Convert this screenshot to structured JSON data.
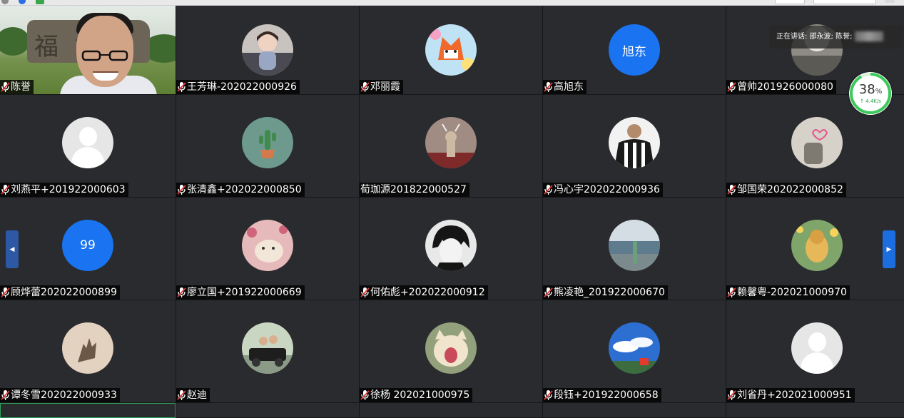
{
  "colors": {
    "tile_bg": "#2a2b2e",
    "nameplate_bg": "#000000",
    "accent_blue": "#1a73f0",
    "net_green": "#3cc85a"
  },
  "speaking_label": "正在讲话: 邵永波; 陈誉;",
  "network": {
    "percent": "38",
    "percent_unit": "%",
    "rate": "↑ 4.4K/s",
    "level": 0.38
  },
  "participants": [
    {
      "name": "陈誉",
      "avatar": "camera",
      "mic": true
    },
    {
      "name": "王芳琳-202022000926",
      "avatar": "girl-photo",
      "mic": true
    },
    {
      "name": "邓丽霞",
      "avatar": "cartoon-fox",
      "mic": true
    },
    {
      "name": "高旭东",
      "avatar": "text",
      "avatar_text": "旭东",
      "color": "#1a73f0",
      "mic": true
    },
    {
      "name": "曾帅201926000080",
      "avatar": "mirror-photo",
      "mic": true
    },
    {
      "name": "刘燕平+201922000603",
      "avatar": "default",
      "mic": true
    },
    {
      "name": "张清鑫+202022000850",
      "avatar": "cactus",
      "mic": true
    },
    {
      "name": "荀珈源201822000527",
      "avatar": "deer-art",
      "mic": false
    },
    {
      "name": "冯心宇202022000936",
      "avatar": "footballer",
      "mic": true
    },
    {
      "name": "邹国荣202022000852",
      "avatar": "doodle-heart",
      "mic": true
    },
    {
      "name": "顾烨蕾202022000899",
      "avatar": "text",
      "avatar_text": "99",
      "color": "#1a73f0",
      "mic": true
    },
    {
      "name": "廖立国+201922000669",
      "avatar": "cat-flowers",
      "mic": true
    },
    {
      "name": "何佑彪+202022000912",
      "avatar": "anime-boy",
      "mic": true
    },
    {
      "name": "熊凌艳_201922000670",
      "avatar": "sea-shore",
      "mic": true
    },
    {
      "name": "赖馨粤-202021000970",
      "avatar": "dog-painting",
      "mic": true
    },
    {
      "name": "谭冬雪202022000933",
      "avatar": "hand-shadow",
      "mic": true
    },
    {
      "name": "赵迪",
      "avatar": "kids-car",
      "mic": true
    },
    {
      "name": "徐杨 202021000975",
      "avatar": "cat-yawn",
      "mic": true
    },
    {
      "name": "段钰+201922000658",
      "avatar": "sky-clouds",
      "mic": true
    },
    {
      "name": "刘省丹+202021000951",
      "avatar": "default",
      "mic": true
    }
  ],
  "bottom_row_count": 5
}
